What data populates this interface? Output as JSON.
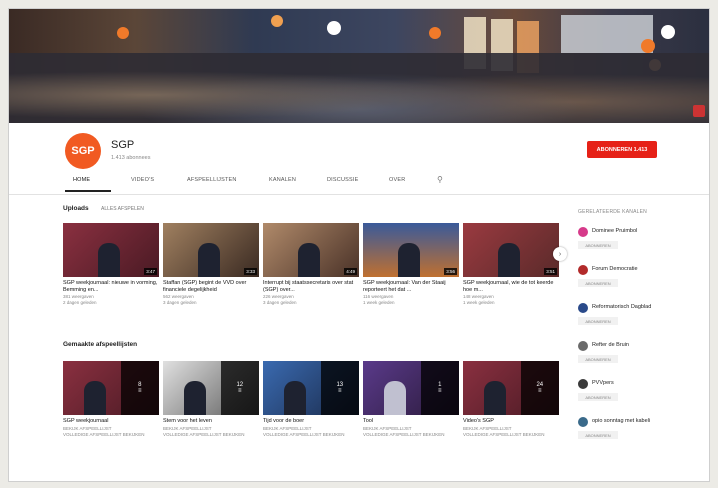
{
  "channel": {
    "name": "SGP",
    "logo_text": "SGP",
    "subscribers": "1.413 abonnees",
    "subscribe_label": "ABONNEREN 1.413",
    "brand_color": "#f15a22",
    "subscribe_color": "#e62117"
  },
  "tabs": [
    {
      "label": "HOME",
      "active": true
    },
    {
      "label": "VIDEO'S",
      "active": false
    },
    {
      "label": "AFSPEELLIJSTEN",
      "active": false
    },
    {
      "label": "KANALEN",
      "active": false
    },
    {
      "label": "DISCUSSIE",
      "active": false
    },
    {
      "label": "OVER",
      "active": false
    }
  ],
  "search_icon": "search-icon",
  "uploads": {
    "title": "Uploads",
    "play_all": "ALLES AFSPELEN",
    "videos": [
      {
        "title": "SGP weekjournaal: nieuwe in vorming, Bemming en...",
        "views": "381 weergaven",
        "age": "2 dagen geleden",
        "duration": "3:47",
        "color": "#6a2230"
      },
      {
        "title": "Staffan (SGP) begint de VVD over financiele degelijkheid",
        "views": "562 weergaven",
        "age": "3 dagen geleden",
        "duration": "3:33",
        "color": "#5c4a3a"
      },
      {
        "title": "Interrupt bij staatssecretaris over stat (SGP) over...",
        "views": "226 weergaven",
        "age": "3 dagen geleden",
        "duration": "4:49",
        "color": "#7a5a4a"
      },
      {
        "title": "SGP weekjournaal: Van der Staaij reporteert het dat ...",
        "views": "116 weergaven",
        "age": "1 week geleden",
        "duration": "3:56",
        "color": "#3a4a6a"
      },
      {
        "title": "SGP weekjournaal, wie de tot keerde hoe m...",
        "views": "148 weergaven",
        "age": "1 week geleden",
        "duration": "3:51",
        "color": "#6a2a30"
      }
    ]
  },
  "playlists": {
    "title": "Gemaakte afspeellijsten",
    "items": [
      {
        "title": "SGP weekjournaal",
        "overlay_count": "8",
        "link": "VOLLEDIGE AFSPEELLIJST BEKIJKEN",
        "sub": "BEKIJK AFSPEELLIJST",
        "color": "#5a2230"
      },
      {
        "title": "Stem voor het leven",
        "overlay_count": "12",
        "link": "VOLLEDIGE AFSPEELLIJST BEKIJKEN",
        "sub": "BEKIJK AFSPEELLIJST",
        "color": "#4a4a4a"
      },
      {
        "title": "Tijd voor de boer",
        "overlay_count": "13",
        "link": "VOLLEDIGE AFSPEELLIJST BEKIJKEN",
        "sub": "BEKIJK AFSPEELLIJST",
        "color": "#2a4a7a"
      },
      {
        "title": "Tool",
        "overlay_count": "1",
        "link": "VOLLEDIGE AFSPEELLIJST BEKIJKEN",
        "sub": "BEKIJK AFSPEELLIJST",
        "color": "#3a2a5a"
      },
      {
        "title": "Video's SGP",
        "overlay_count": "24",
        "link": "VOLLEDIGE AFSPEELLIJST BEKIJKEN",
        "sub": "BEKIJK AFSPEELLIJST",
        "color": "#5a2a2a"
      }
    ]
  },
  "sidebar": {
    "title": "GERELATEERDE KANALEN",
    "channels": [
      {
        "name": "Dominee Pruimbol",
        "button": "ABONNEREN",
        "avatar_color": "#d63a8a"
      },
      {
        "name": "Forum Democratie",
        "button": "ABONNEREN",
        "avatar_color": "#b22a2a"
      },
      {
        "name": "Reformatorisch Dagblad",
        "button": "ABONNEREN",
        "avatar_color": "#2a4a8a"
      },
      {
        "name": "Refter de Bruin",
        "button": "ABONNEREN",
        "avatar_color": "#6a6a6a"
      },
      {
        "name": "PVVpers",
        "button": "ABONNEREN",
        "avatar_color": "#3a3a3a"
      },
      {
        "name": "opio sonntag met kabeli",
        "button": "ABONNEREN",
        "avatar_color": "#3a6a8a"
      }
    ]
  }
}
